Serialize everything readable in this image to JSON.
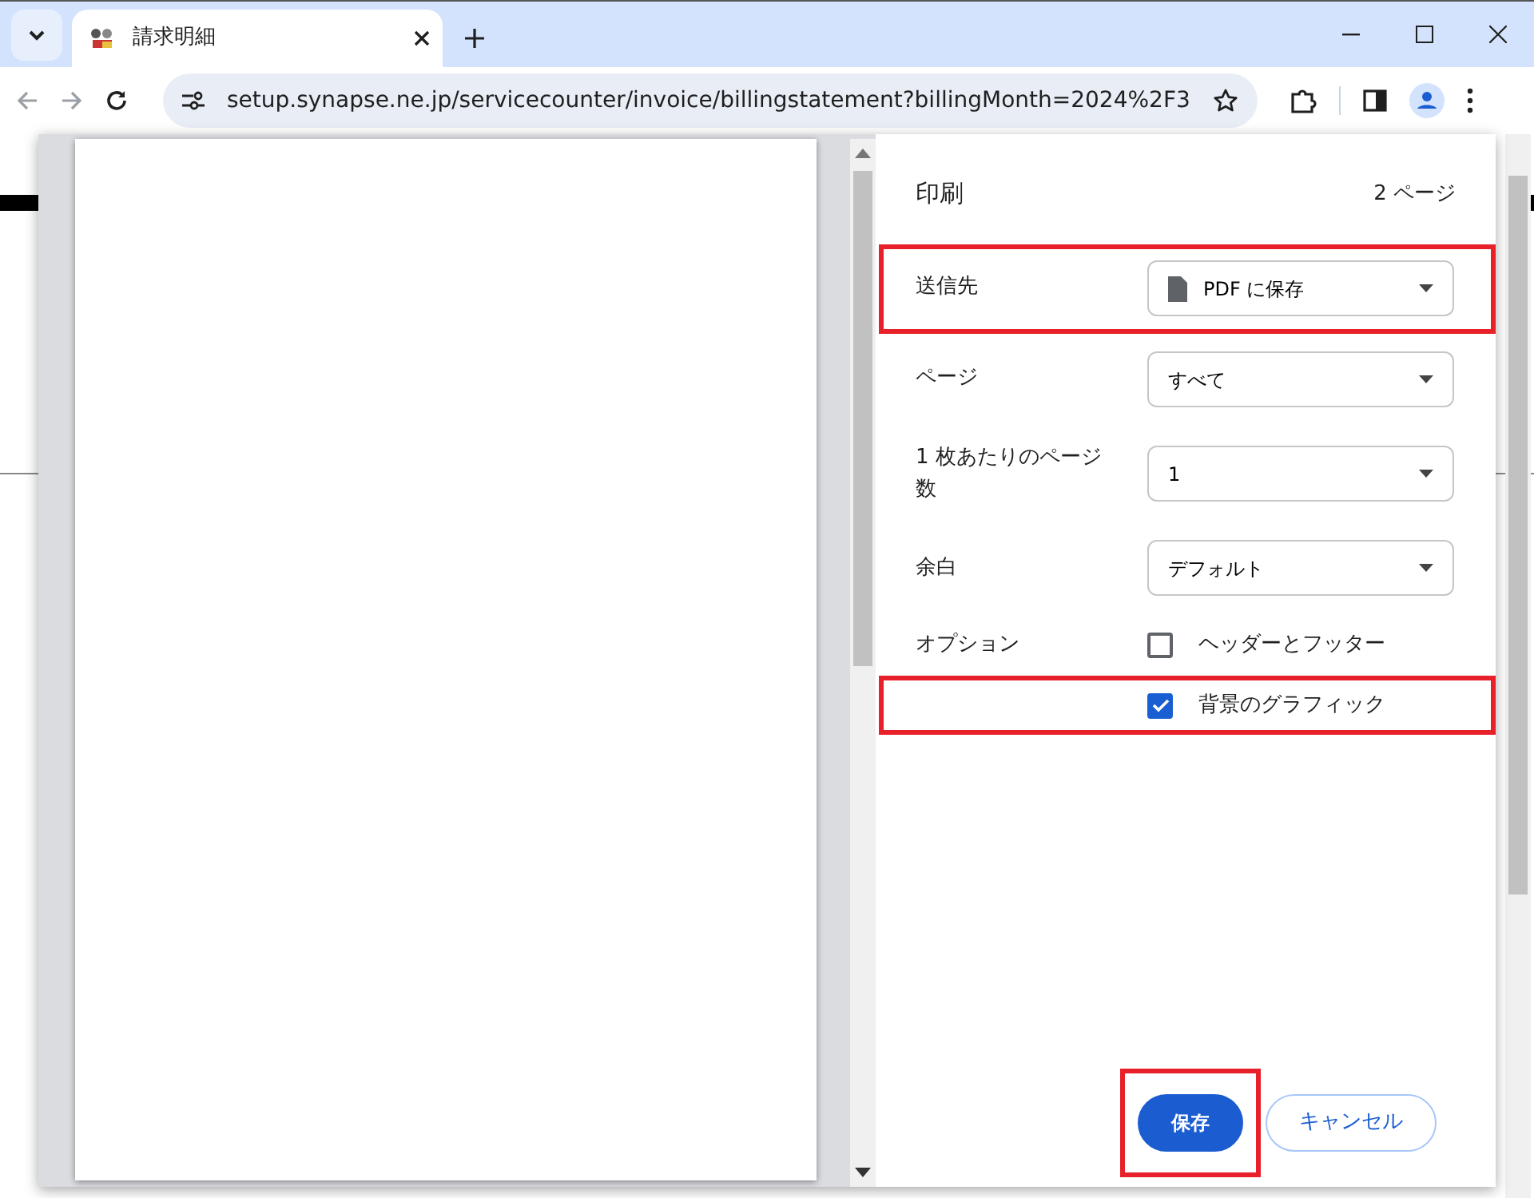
{
  "browser": {
    "tab": {
      "title": "請求明細"
    },
    "address": "setup.synapse.ne.jp/servicecounter/invoice/billingstatement?billingMonth=2024%2F3"
  },
  "print_dialog": {
    "title": "印刷",
    "page_count": "2 ページ",
    "settings": [
      {
        "label": "送信先",
        "value": "PDF に保存",
        "kind": "destination",
        "highlighted": true
      },
      {
        "label": "ページ",
        "value": "すべて",
        "kind": "select",
        "highlighted": false
      },
      {
        "label": "1 枚あたりのページ数",
        "value": "1",
        "kind": "select",
        "highlighted": false
      },
      {
        "label": "余白",
        "value": "デフォルト",
        "kind": "select",
        "highlighted": false
      }
    ],
    "options_label": "オプション",
    "options": [
      {
        "label": "ヘッダーとフッター",
        "checked": false,
        "highlighted": false
      },
      {
        "label": "背景のグラフィック",
        "checked": true,
        "highlighted": true
      }
    ],
    "buttons": [
      {
        "label": "保存",
        "kind": "primary",
        "highlighted": true
      },
      {
        "label": "キャンセル",
        "kind": "secondary",
        "highlighted": false
      }
    ]
  }
}
